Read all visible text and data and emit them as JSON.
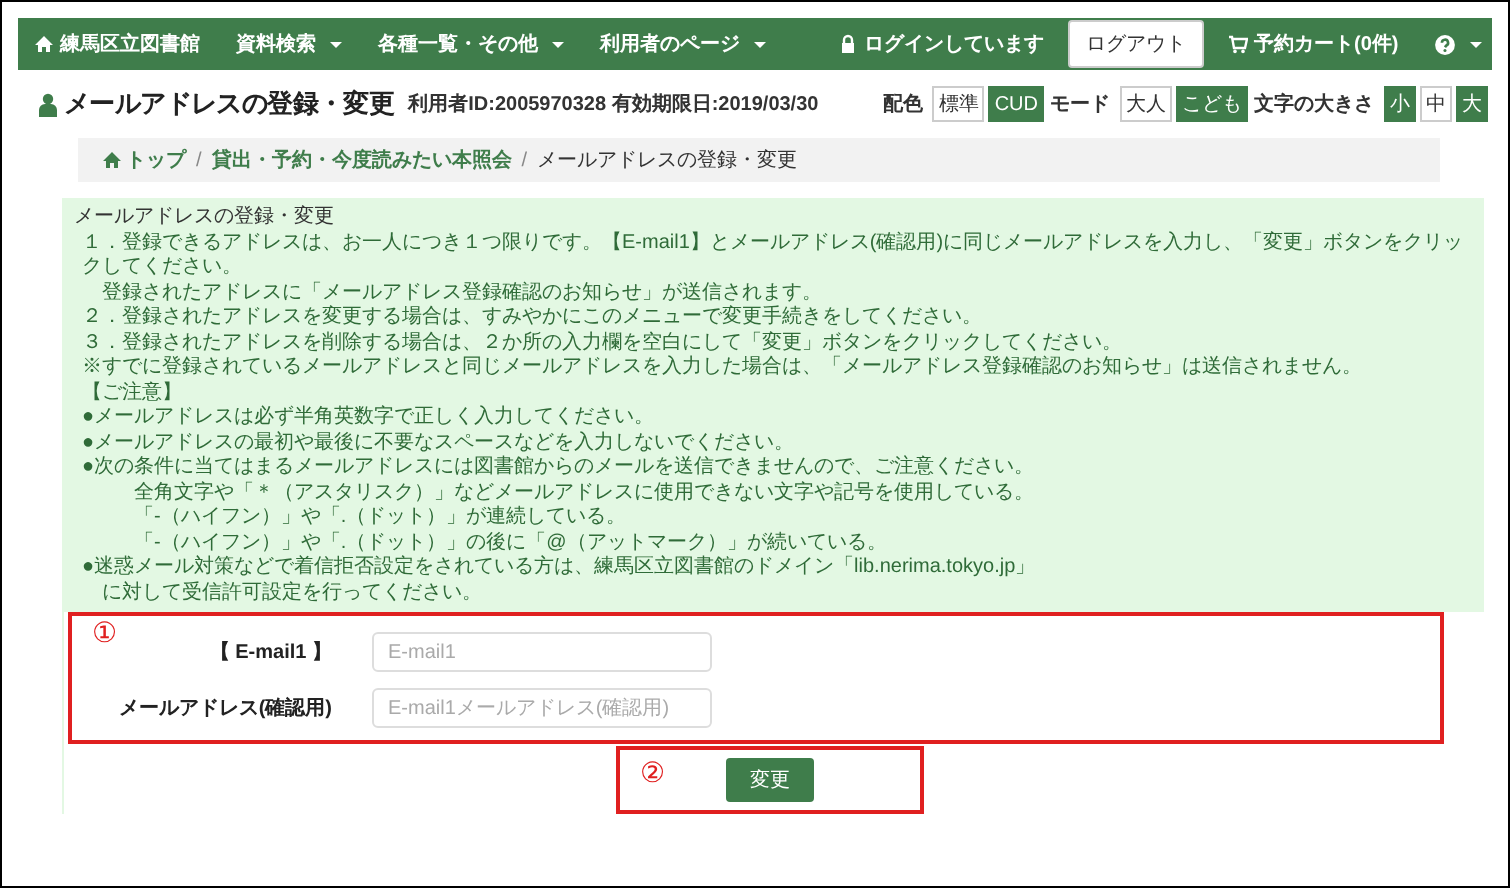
{
  "navbar": {
    "brand": "練馬区立図書館",
    "menus": [
      {
        "label": "資料検索",
        "caret": true
      },
      {
        "label": "各種一覧・その他",
        "caret": true
      },
      {
        "label": "利用者のページ",
        "caret": true
      }
    ],
    "login_status": "ログインしています",
    "logout": "ログアウト",
    "cart": "予約カート(0件)",
    "help_caret": true
  },
  "page_title": "メールアドレスの登録・変更",
  "user_info": "利用者ID:2005970328 有効期限日:2019/03/30",
  "display_options": [
    {
      "label": "配色",
      "buttons": [
        {
          "label": "標準",
          "filled": false
        },
        {
          "label": "CUD",
          "filled": true
        }
      ]
    },
    {
      "label": "モード",
      "buttons": [
        {
          "label": "大人",
          "filled": false
        },
        {
          "label": "こども",
          "filled": true
        }
      ]
    },
    {
      "label": "文字の大きさ",
      "buttons": [
        {
          "label": "小",
          "filled": true
        },
        {
          "label": "中",
          "filled": false
        },
        {
          "label": "大",
          "filled": true
        }
      ]
    }
  ],
  "breadcrumb": {
    "separator": "/",
    "items": [
      "トップ",
      "貸出・予約・今度読みたい本照会",
      "メールアドレスの登録・変更"
    ]
  },
  "notice": [
    {
      "kind": "heading",
      "text": "メールアドレスの登録・変更"
    },
    {
      "kind": "item",
      "text": "１．登録できるアドレスは、お一人につき１つ限りです。【E-mail1】とメールアドレス(確認用)に同じメールアドレスを入力し、「変更」ボタンをクリックしてください。"
    },
    {
      "kind": "cont",
      "text": "登録されたアドレスに「メールアドレス登録確認のお知らせ」が送信されます。"
    },
    {
      "kind": "item",
      "text": "２．登録されたアドレスを変更する場合は、すみやかにこのメニューで変更手続きをしてください。"
    },
    {
      "kind": "item",
      "text": "３．登録されたアドレスを削除する場合は、２か所の入力欄を空白にして「変更」ボタンをクリックしてください。"
    },
    {
      "kind": "note",
      "text": "※すでに登録されているメールアドレスと同じメールアドレスを入力した場合は、「メールアドレス登録確認のお知らせ」は送信されません。"
    },
    {
      "kind": "note",
      "text": "【ご注意】"
    },
    {
      "kind": "note",
      "text": "●メールアドレスは必ず半角英数字で正しく入力してください。"
    },
    {
      "kind": "note",
      "text": "●メールアドレスの最初や最後に不要なスペースなどを入力しないでください。"
    },
    {
      "kind": "note",
      "text": "●次の条件に当てはまるメールアドレスには図書館からのメールを送信できませんので、ご注意ください。"
    },
    {
      "kind": "sub",
      "text": "全角文字や「＊（アスタリスク）」などメールアドレスに使用できない文字や記号を使用している。"
    },
    {
      "kind": "sub",
      "text": "「-（ハイフン）」や「.（ドット）」が連続している。"
    },
    {
      "kind": "sub",
      "text": "「-（ハイフン）」や「.（ドット）」の後に「@（アットマーク）」が続いている。"
    },
    {
      "kind": "note",
      "text": "●迷惑メール対策などで着信拒否設定をされている方は、練馬区立図書館のドメイン「lib.nerima.tokyo.jp」"
    },
    {
      "kind": "cont",
      "text": "に対して受信許可設定を行ってください。"
    }
  ],
  "form": {
    "annotation": "①",
    "fields": [
      {
        "label": "【 E-mail1 】",
        "placeholder": "E-mail1"
      },
      {
        "label": "メールアドレス(確認用)",
        "placeholder": "E-mail1メールアドレス(確認用)"
      }
    ]
  },
  "submit": {
    "annotation": "②",
    "label": "変更"
  }
}
